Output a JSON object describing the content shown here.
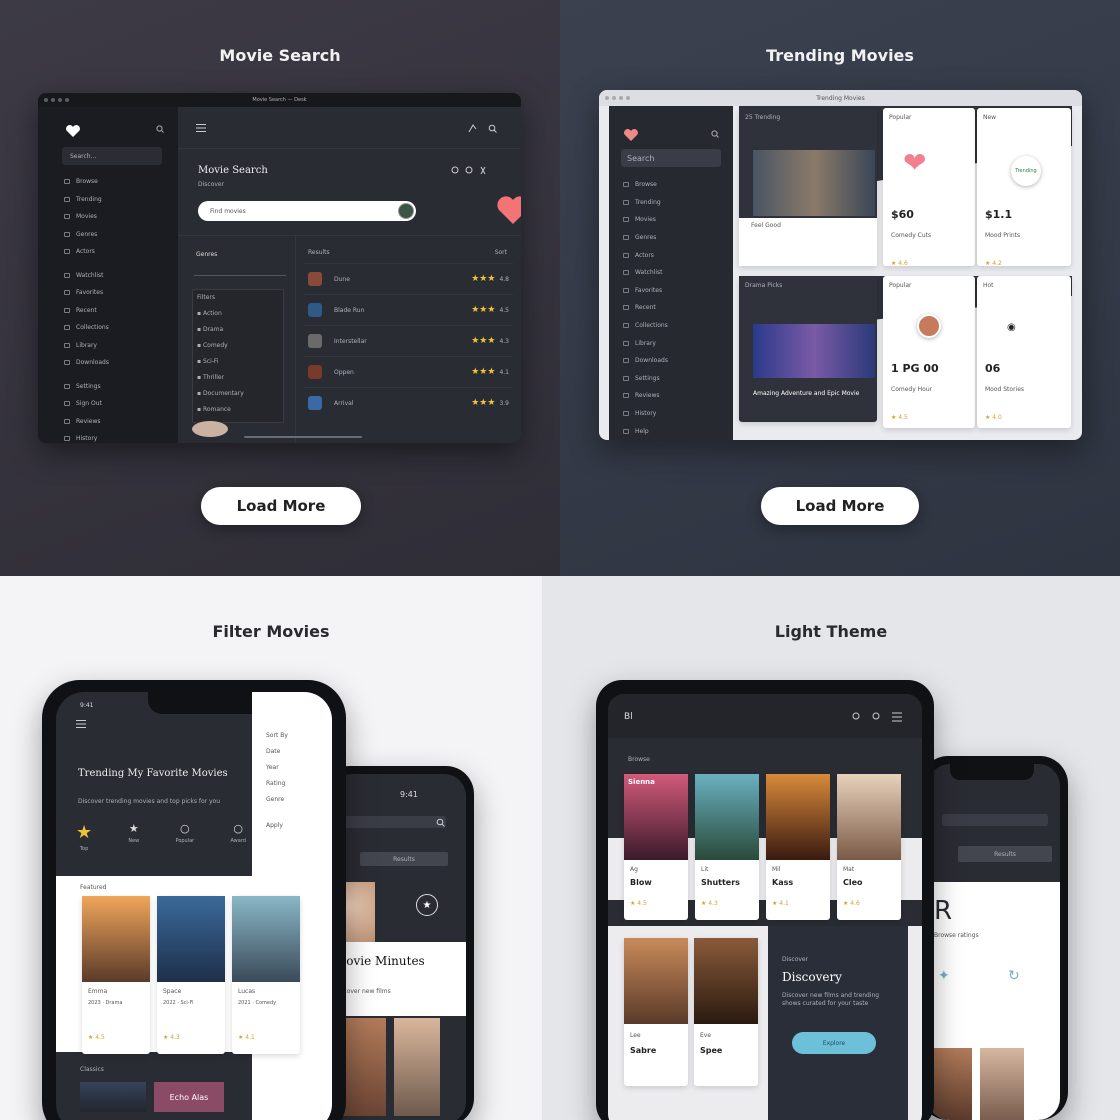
{
  "q1": {
    "title": "Movie Search",
    "window_title": "Movie Search — Desk",
    "search_placeholder": "Search...",
    "page_heading": "Movie Search",
    "page_sub": "Discover",
    "search_value": "Find movies",
    "sidebar_items": [
      "Browse",
      "Trending",
      "Movies",
      "Genres",
      "Actors",
      "Watchlist",
      "Favorites",
      "Recent",
      "Collections",
      "Library",
      "Downloads",
      "Settings",
      "Sign Out",
      "Reviews",
      "History"
    ],
    "filters_label": "Genres",
    "filter_box_title": "Filters",
    "filter_items": [
      "Action",
      "Drama",
      "Comedy",
      "Sci-Fi",
      "Thriller",
      "Documentary",
      "Romance"
    ],
    "results_header": "Results",
    "results_header_right": "Sort",
    "results": [
      {
        "name": "Dune",
        "rating": "4.8"
      },
      {
        "name": "Blade Run",
        "rating": "4.5"
      },
      {
        "name": "Interstellar",
        "rating": "4.3"
      },
      {
        "name": "Oppen",
        "rating": "4.1"
      },
      {
        "name": "Arrival",
        "rating": "3.9"
      }
    ],
    "load_more": "Load More"
  },
  "q2": {
    "title": "Trending Movies",
    "window_title": "Trending Movies",
    "search_value": "Search",
    "sidebar_items": [
      "Browse",
      "Trending",
      "Movies",
      "Genres",
      "Actors",
      "Watchlist",
      "Favorites",
      "Recent",
      "Collections",
      "Library",
      "Downloads",
      "Settings",
      "Reviews",
      "History",
      "Help"
    ],
    "cards": [
      {
        "label": "25 Trending",
        "price": "",
        "title": "",
        "meta": ""
      },
      {
        "label": "Popular",
        "price": "$60",
        "title": "Comedy Cuts",
        "meta": "★ 4.6"
      },
      {
        "label": "New",
        "price": "$1.1",
        "title": "Mood Prints",
        "meta": "★ 4.2"
      },
      {
        "label": "Drama Picks",
        "price": "",
        "title": "",
        "meta": ""
      },
      {
        "label": "Popular",
        "price": "1 PG 00",
        "title": "Comedy Hour",
        "meta": "★ 4.5"
      },
      {
        "label": "Hot",
        "price": "06",
        "title": "Mood Stories",
        "meta": "★ 4.0"
      }
    ],
    "card1_sub": "Feel Good",
    "card4_caption": "Amazing Adventure and Epic Movie",
    "badge_text": "Trending",
    "load_more": "Load More"
  },
  "q3": {
    "title": "Filter Movies",
    "time": "9:41",
    "heading": "Trending My Favorite Movies",
    "caption": "Discover trending movies and top picks for you",
    "filter_labels": [
      "Top",
      "New",
      "Popular",
      "Award"
    ],
    "filters_panel": [
      "Sort By",
      "Date",
      "Year",
      "Rating",
      "Genre",
      "Apply"
    ],
    "section_label": "Featured",
    "movie_cards": [
      {
        "title": "Emma",
        "meta": "2023 · Drama",
        "rating": "★ 4.5"
      },
      {
        "title": "Space",
        "meta": "2022 · Sci-Fi",
        "rating": "★ 4.3"
      },
      {
        "title": "Lucas",
        "meta": "2021 · Comedy",
        "rating": "★ 4.1"
      }
    ],
    "bottom_label": "Classics",
    "bottom_poster": "Echo Alas",
    "phone2_status": "9:41",
    "phone2_button": "Results",
    "phone2_heading": "Movie Minutes",
    "phone2_sub": "Discover new films"
  },
  "q4": {
    "title": "Light Theme",
    "topbar_left": "Bl",
    "section": "Browse",
    "posters": [
      "Sienna",
      "",
      "",
      ""
    ],
    "cards": [
      {
        "t1": "Ag",
        "t2": "Blow",
        "meta": "★ 4.5"
      },
      {
        "t1": "Lit",
        "t2": "Shutters",
        "meta": "★ 4.3"
      },
      {
        "t1": "Mil",
        "t2": "Kass",
        "meta": "★ 4.1"
      },
      {
        "t1": "Mat",
        "t2": "Cleo",
        "meta": "★ 4.6"
      }
    ],
    "bottom_cards": [
      {
        "t1": "Lee",
        "t2": "Sabre"
      },
      {
        "t1": "Eve",
        "t2": "Spee"
      }
    ],
    "discovery_label": "Discover",
    "discovery_title": "Discovery",
    "discovery_text": "Discover new films and trending shows curated for your taste",
    "discovery_button": "Explore",
    "phone2_button": "Results",
    "phone2_big": "R",
    "phone2_caption": "Browse ratings"
  }
}
